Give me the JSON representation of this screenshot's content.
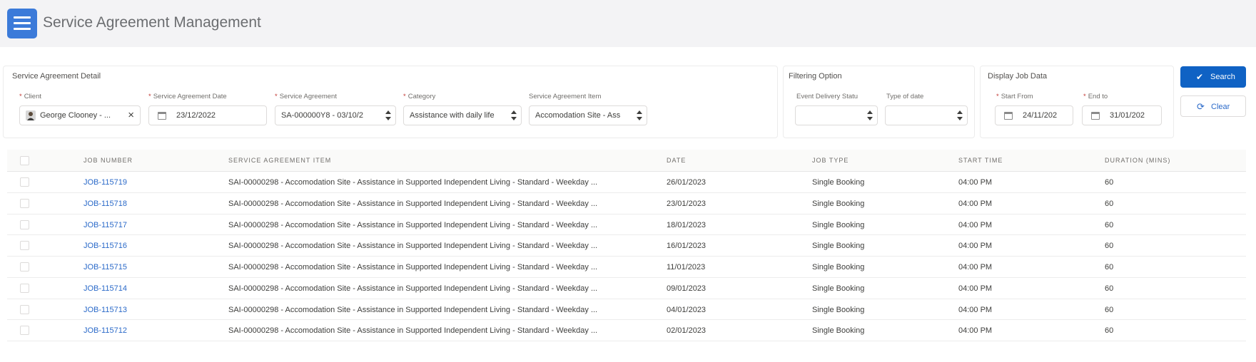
{
  "app": {
    "title": "Service Agreement Management",
    "icon": "menu-icon",
    "accent_color": "#3b7ad9"
  },
  "service_agreement_detail": {
    "title": "Service Agreement Detail",
    "client": {
      "label": "Client",
      "value": "George Clooney - ...",
      "icon": "person-avatar-icon"
    },
    "agreement_date": {
      "label": "Service Agreement Date",
      "value": "23/12/2022",
      "icon": "calendar-icon"
    },
    "service_agreement": {
      "label": "Service Agreement",
      "value": "SA-000000Y8 - 03/10/2"
    },
    "category": {
      "label": "Category",
      "value": "Assistance with daily life"
    },
    "agreement_item": {
      "label": "Service Agreement Item",
      "value": "Accomodation Site - Ass"
    }
  },
  "filtering_option": {
    "title": "Filtering Option",
    "event_delivery_status": {
      "label": "Event Delivery Statu",
      "value": ""
    },
    "type_of_date": {
      "label": "Type of date",
      "value": ""
    }
  },
  "display_job_data": {
    "title": "Display Job Data",
    "start_from": {
      "label": "Start From",
      "value": "24/11/202"
    },
    "end_to": {
      "label": "End to",
      "value": "31/01/202"
    }
  },
  "actions": {
    "search_label": "Search",
    "clear_label": "Clear",
    "search_color": "#0f62c4"
  },
  "table": {
    "columns": [
      "JOB NUMBER",
      "SERVICE AGREEMENT ITEM",
      "DATE",
      "JOB TYPE",
      "START TIME",
      "DURATION (MINS)"
    ],
    "rows": [
      {
        "job": "JOB-115719",
        "item": "SAI-00000298 - Accomodation Site - Assistance in Supported Independent Living - Standard - Weekday ...",
        "date": "26/01/2023",
        "type": "Single Booking",
        "start": "04:00 PM",
        "duration": "60"
      },
      {
        "job": "JOB-115718",
        "item": "SAI-00000298 - Accomodation Site - Assistance in Supported Independent Living - Standard - Weekday ...",
        "date": "23/01/2023",
        "type": "Single Booking",
        "start": "04:00 PM",
        "duration": "60"
      },
      {
        "job": "JOB-115717",
        "item": "SAI-00000298 - Accomodation Site - Assistance in Supported Independent Living - Standard - Weekday ...",
        "date": "18/01/2023",
        "type": "Single Booking",
        "start": "04:00 PM",
        "duration": "60"
      },
      {
        "job": "JOB-115716",
        "item": "SAI-00000298 - Accomodation Site - Assistance in Supported Independent Living - Standard - Weekday ...",
        "date": "16/01/2023",
        "type": "Single Booking",
        "start": "04:00 PM",
        "duration": "60"
      },
      {
        "job": "JOB-115715",
        "item": "SAI-00000298 - Accomodation Site - Assistance in Supported Independent Living - Standard - Weekday ...",
        "date": "11/01/2023",
        "type": "Single Booking",
        "start": "04:00 PM",
        "duration": "60"
      },
      {
        "job": "JOB-115714",
        "item": "SAI-00000298 - Accomodation Site - Assistance in Supported Independent Living - Standard - Weekday ...",
        "date": "09/01/2023",
        "type": "Single Booking",
        "start": "04:00 PM",
        "duration": "60"
      },
      {
        "job": "JOB-115713",
        "item": "SAI-00000298 - Accomodation Site - Assistance in Supported Independent Living - Standard - Weekday ...",
        "date": "04/01/2023",
        "type": "Single Booking",
        "start": "04:00 PM",
        "duration": "60"
      },
      {
        "job": "JOB-115712",
        "item": "SAI-00000298 - Accomodation Site - Assistance in Supported Independent Living - Standard - Weekday ...",
        "date": "02/01/2023",
        "type": "Single Booking",
        "start": "04:00 PM",
        "duration": "60"
      }
    ]
  }
}
